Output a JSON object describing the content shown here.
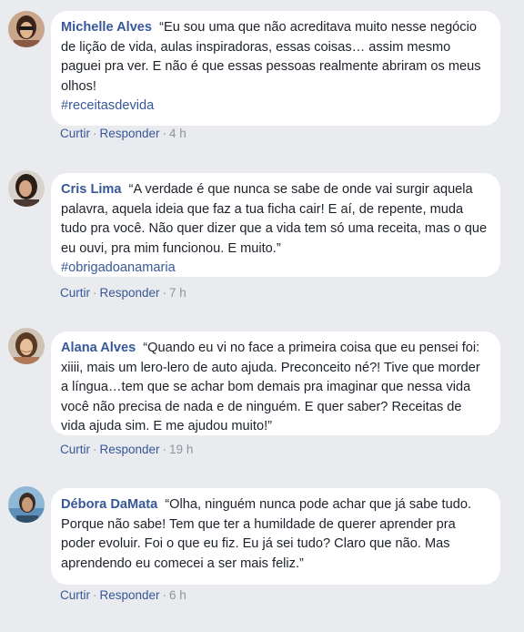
{
  "comments": [
    {
      "author": "Michelle Alves",
      "text": "“Eu sou uma que não acreditava muito nesse negócio de lição de vida, aulas inspiradoras, essas coisas… assim mesmo paguei pra ver. E não é que essas pessoas realmente abriram os meus olhos!",
      "hashtag": "#receitasdevida",
      "actions": {
        "cut": "Curtir",
        "reply": "Responder",
        "time": "4 h"
      },
      "avatar_color": "#8a5a44"
    },
    {
      "author": "Cris Lima",
      "text": "“A verdade é que nunca se sabe de onde vai surgir aquela palavra, aquela ideia que faz a tua ficha cair! E aí, de repente, muda tudo pra você. Não quer dizer que a vida tem só uma receita, mas o que eu ouvi, pra mim funcionou. E muito.”",
      "hashtag": "#obrigadoanamaria",
      "actions": {
        "cut": "Curtir",
        "reply": "Responder",
        "time": "7 h"
      },
      "avatar_color": "#4a3a32"
    },
    {
      "author": "Alana Alves",
      "text": "“Quando eu vi no face a primeira coisa que eu pensei foi: xiiii, mais um lero-lero de auto ajuda. Preconceito né?! Tive que morder a língua…tem que se achar bom demais pra imaginar que nessa vida você não precisa de nada e de ninguém. E quer saber? Receitas de vida ajuda sim. E me ajudou muito!”",
      "hashtag": "",
      "actions": {
        "cut": "Curtir",
        "reply": "Responder",
        "time": "19 h"
      },
      "avatar_color": "#b07a58"
    },
    {
      "author": "Débora DaMata",
      "text": "“Olha, ninguém nunca pode achar que já sabe tudo. Porque não sabe! Tem que ter a humildade de querer aprender pra poder evoluir. Foi o que eu fiz. Eu já sei tudo? Claro que não. Mas aprendendo eu comecei a ser mais feliz.”",
      "hashtag": "",
      "actions": {
        "cut": "Curtir",
        "reply": "Responder",
        "time": "6 h"
      },
      "avatar_color": "#5d8fb8"
    }
  ]
}
